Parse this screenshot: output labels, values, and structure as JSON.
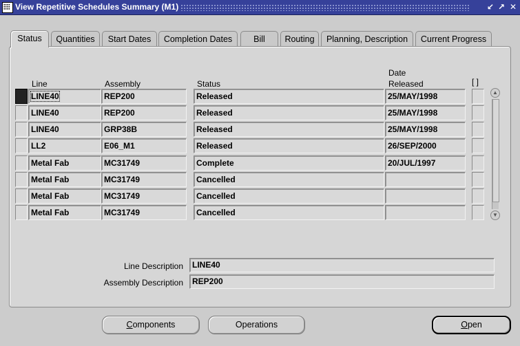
{
  "window": {
    "title": "View Repetitive Schedules Summary (M1)",
    "controls": [
      "↙",
      "↗",
      "✕"
    ]
  },
  "tabs": [
    {
      "label": "Status",
      "active": true
    },
    {
      "label": "Quantities"
    },
    {
      "label": "Start Dates"
    },
    {
      "label": "Completion Dates"
    },
    {
      "label": "Bill"
    },
    {
      "label": "Routing"
    },
    {
      "label": "Planning, Description"
    },
    {
      "label": "Current Progress"
    }
  ],
  "table": {
    "headers": {
      "line": "Line",
      "assembly": "Assembly",
      "status": "Status",
      "date_released_1": "Date",
      "date_released_2": "Released",
      "check": "[ ]"
    },
    "rows": [
      {
        "line": "LINE40",
        "assembly": "REP200",
        "status": "Released",
        "date": "25/MAY/1998"
      },
      {
        "line": "LINE40",
        "assembly": "REP200",
        "status": "Released",
        "date": "25/MAY/1998"
      },
      {
        "line": "LINE40",
        "assembly": "GRP38B",
        "status": "Released",
        "date": "25/MAY/1998"
      },
      {
        "line": "LL2",
        "assembly": "E06_M1",
        "status": "Released",
        "date": "26/SEP/2000"
      },
      {
        "line": "Metal Fab",
        "assembly": "MC31749",
        "status": "Complete",
        "date": "20/JUL/1997"
      },
      {
        "line": "Metal Fab",
        "assembly": "MC31749",
        "status": "Cancelled",
        "date": ""
      },
      {
        "line": "Metal Fab",
        "assembly": "MC31749",
        "status": "Cancelled",
        "date": ""
      },
      {
        "line": "Metal Fab",
        "assembly": "MC31749",
        "status": "Cancelled",
        "date": ""
      }
    ]
  },
  "details": {
    "line_description_label": "Line Description",
    "line_description_value": "LINE40",
    "assembly_description_label": "Assembly Description",
    "assembly_description_value": "REP200"
  },
  "buttons": {
    "components_prefix": "",
    "components_mnemonic": "C",
    "components_rest": "omponents",
    "operations": "Operations",
    "open_mnemonic": "O",
    "open_rest": "pen"
  }
}
